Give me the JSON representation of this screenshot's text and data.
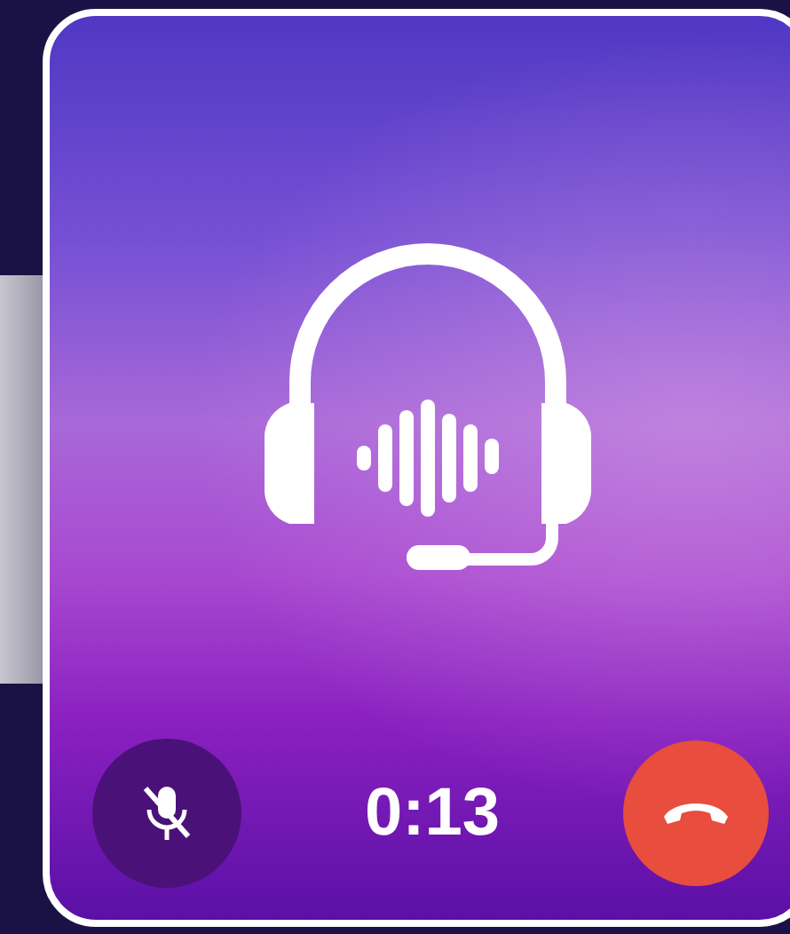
{
  "call": {
    "timer": "0:13",
    "muted": true
  }
}
